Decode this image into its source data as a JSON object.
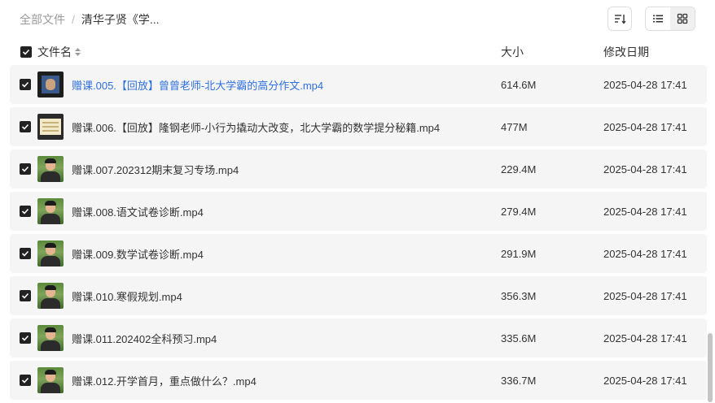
{
  "breadcrumb": {
    "root": "全部文件",
    "separator": "/",
    "current": "清华子贤《学..."
  },
  "header": {
    "name": "文件名",
    "size": "大小",
    "date": "修改日期"
  },
  "files": [
    {
      "name": "赠课.005.【回放】曾曾老师-北大学霸的高分作文.mp4",
      "size": "614.6M",
      "date": "2025-04-28 17:41",
      "thumb": "dark",
      "hovered": true
    },
    {
      "name": "赠课.006.【回放】隆钢老师-小行为撬动大改变，北大学霸的数学提分秘籍.mp4",
      "size": "477M",
      "date": "2025-04-28 17:41",
      "thumb": "board",
      "hovered": false
    },
    {
      "name": "赠课.007.202312期末复习专场.mp4",
      "size": "229.4M",
      "date": "2025-04-28 17:41",
      "thumb": "person",
      "hovered": false
    },
    {
      "name": "赠课.008.语文试卷诊断.mp4",
      "size": "279.4M",
      "date": "2025-04-28 17:41",
      "thumb": "person",
      "hovered": false
    },
    {
      "name": "赠课.009.数学试卷诊断.mp4",
      "size": "291.9M",
      "date": "2025-04-28 17:41",
      "thumb": "person",
      "hovered": false
    },
    {
      "name": "赠课.010.寒假规划.mp4",
      "size": "356.3M",
      "date": "2025-04-28 17:41",
      "thumb": "person",
      "hovered": false
    },
    {
      "name": "赠课.011.202402全科预习.mp4",
      "size": "335.6M",
      "date": "2025-04-28 17:41",
      "thumb": "person",
      "hovered": false
    },
    {
      "name": "赠课.012.开学首月，重点做什么？.mp4",
      "size": "336.7M",
      "date": "2025-04-28 17:41",
      "thumb": "person",
      "hovered": false
    }
  ],
  "icons": {
    "sort": "sort-icon",
    "list": "list-view-icon",
    "grid": "grid-view-icon",
    "check": "check-icon"
  },
  "colors": {
    "link": "#2f6fdf",
    "row_bg": "#f5f5f5",
    "checkbox": "#222222"
  }
}
